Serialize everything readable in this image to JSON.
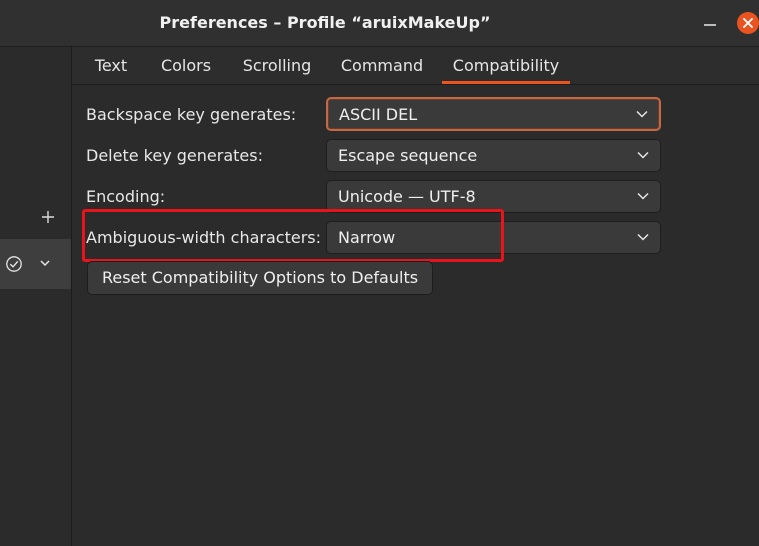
{
  "window": {
    "title": "Preferences – Profile “aruixMakeUp”"
  },
  "sidebar": {
    "add_icon": "plus-icon",
    "profile_icons": [
      "check-circle-icon",
      "chevron-down-icon"
    ]
  },
  "tabs": [
    {
      "label": "Text",
      "active": false
    },
    {
      "label": "Colors",
      "active": false
    },
    {
      "label": "Scrolling",
      "active": false
    },
    {
      "label": "Command",
      "active": false
    },
    {
      "label": "Compatibility",
      "active": true
    }
  ],
  "compatibility": {
    "backspace": {
      "label": "Backspace key generates:",
      "value": "ASCII DEL"
    },
    "delete": {
      "label": "Delete key generates:",
      "value": "Escape sequence"
    },
    "encoding": {
      "label": "Encoding:",
      "value": "Unicode — UTF-8"
    },
    "ambiguous": {
      "label": "Ambiguous-width characters:",
      "value": "Narrow"
    },
    "reset_label": "Reset Compatibility Options to Defaults"
  },
  "colors": {
    "accent": "#e95420",
    "highlight": "#e8131b",
    "background": "#2b2b2b"
  }
}
